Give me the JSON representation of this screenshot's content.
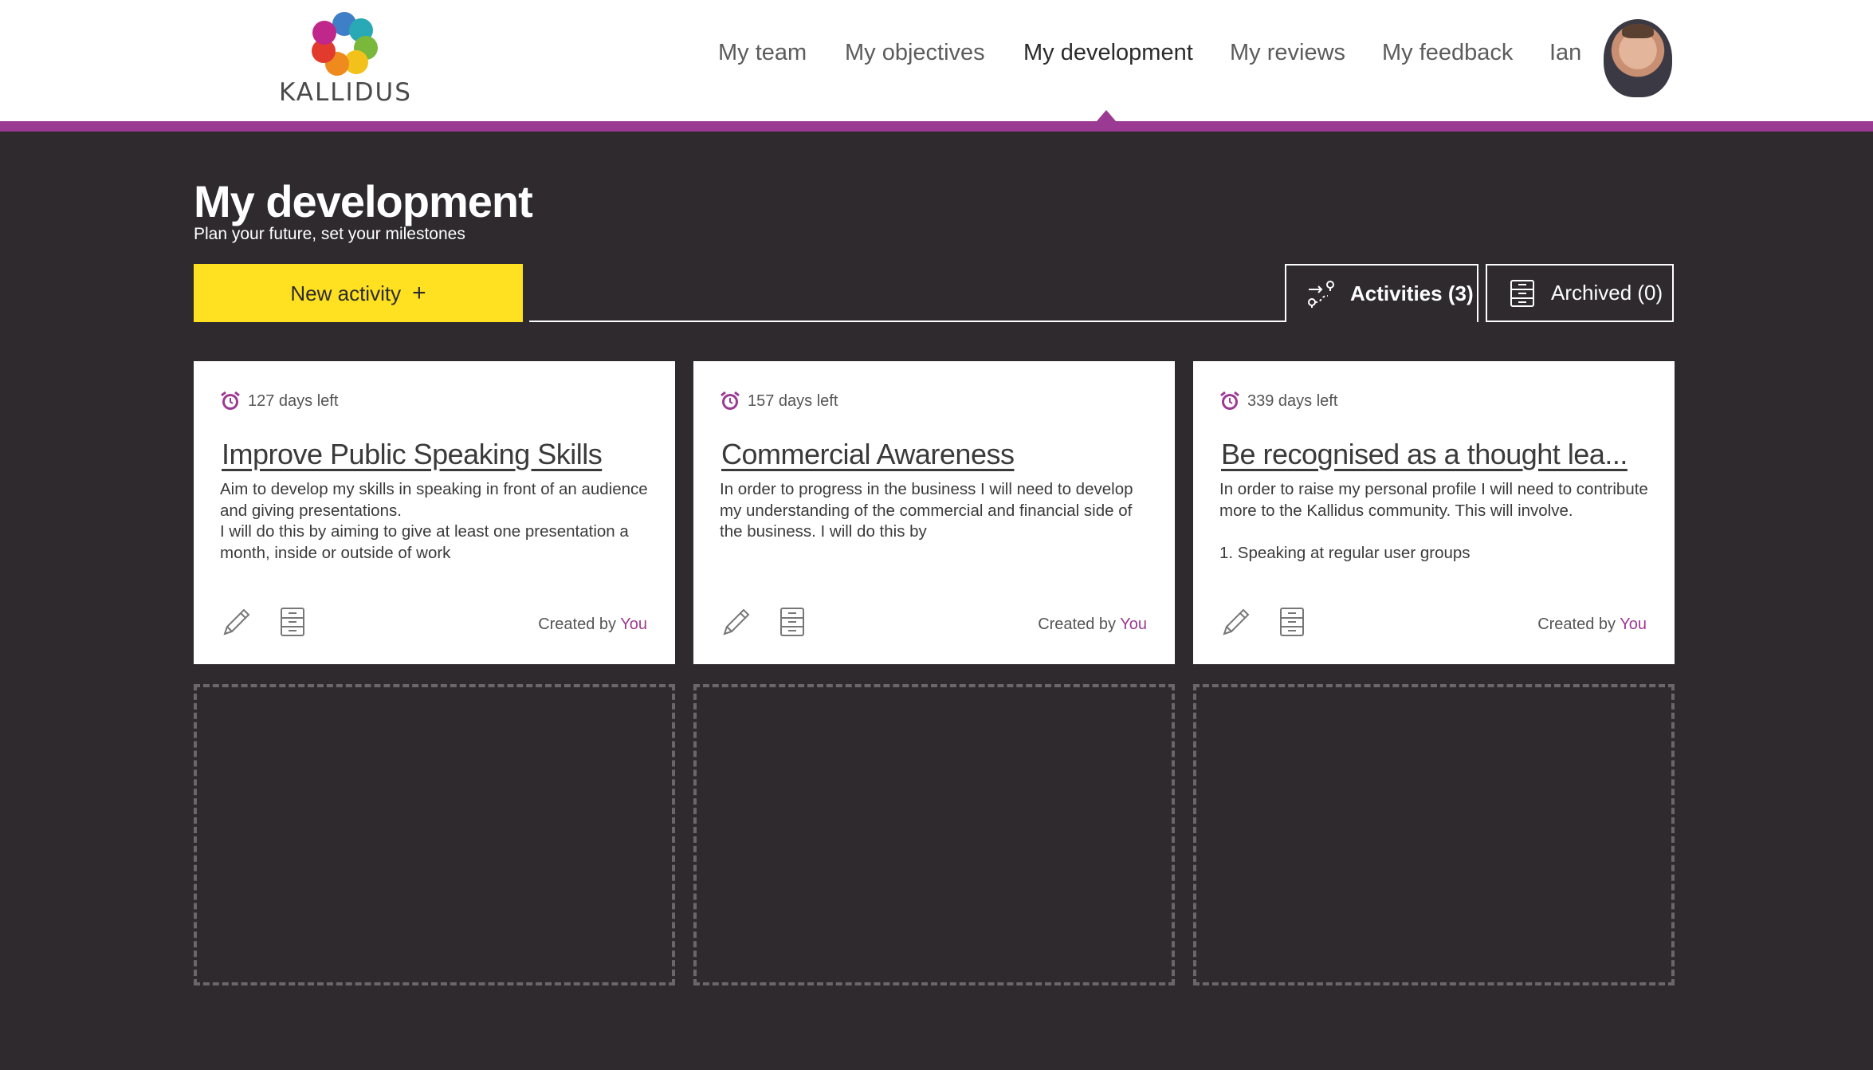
{
  "brand": {
    "name": "KALLIDUS",
    "accent": "#9b3a93",
    "highlight": "#ffe121",
    "background": "#2e2a2e"
  },
  "nav": {
    "items": [
      {
        "label": "My team"
      },
      {
        "label": "My objectives"
      },
      {
        "label": "My development",
        "active": true
      },
      {
        "label": "My reviews"
      },
      {
        "label": "My feedback"
      }
    ],
    "user_name": "Ian",
    "avatar_icon": "user-avatar"
  },
  "page": {
    "title": "My development",
    "subtitle": "Plan your future, set your milestones"
  },
  "toolbar": {
    "new_activity_label": "New activity",
    "new_activity_icon": "+",
    "tabs": [
      {
        "label": "Activities (3)",
        "icon": "route-icon",
        "selected": true
      },
      {
        "label": "Archived (0)",
        "icon": "archive-icon",
        "selected": false
      }
    ]
  },
  "cards": [
    {
      "days_left": "127 days left",
      "title": "Improve Public Speaking Skills",
      "description": "Aim to develop my skills in speaking in front of an audience and giving presentations.\nI will do this by aiming to give at least one presentation a month, inside or outside of work",
      "created_prefix": "Created by",
      "created_by": "You"
    },
    {
      "days_left": "157 days left",
      "title": "Commercial Awareness",
      "description": "In order to progress in the business I will need to develop my understanding of the commercial and financial side of the business. I will do this by",
      "created_prefix": "Created by",
      "created_by": "You"
    },
    {
      "days_left": "339 days left",
      "title": "Be recognised as a thought lea...",
      "description": "In order to raise my personal profile I will need to contribute more to the Kallidus community. This will involve.\n\n1. Speaking at regular user groups",
      "created_prefix": "Created by",
      "created_by": "You"
    }
  ]
}
